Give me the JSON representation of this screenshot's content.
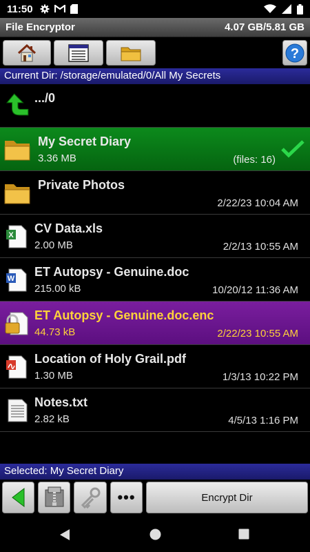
{
  "status": {
    "time": "11:50"
  },
  "title": {
    "app": "File Encryptor",
    "storage": "4.07 GB/5.81 GB"
  },
  "toolbar": {
    "home_icon": "home-icon",
    "list_icon": "list-view-icon",
    "folder_icon": "folder-icon",
    "help_icon": "help-icon"
  },
  "current_dir": "Current Dir: /storage/emulated/0/All My Secrets",
  "parent": {
    "label": ".../0"
  },
  "files": [
    {
      "name": "My Secret Diary",
      "size": "3.36 MB",
      "date": "(files: 16)",
      "type": "folder",
      "state": "selected"
    },
    {
      "name": "Private Photos",
      "size": "",
      "date": "2/22/23 10:04 AM",
      "type": "folder",
      "state": "normal"
    },
    {
      "name": "CV Data.xls",
      "size": "2.00 MB",
      "date": "2/2/13 10:55 AM",
      "type": "xls",
      "state": "normal"
    },
    {
      "name": "ET Autopsy - Genuine.doc",
      "size": "215.00 kB",
      "date": "10/20/12 11:36 AM",
      "type": "doc",
      "state": "normal"
    },
    {
      "name": "ET Autopsy - Genuine.doc.enc",
      "size": "44.73 kB",
      "date": "2/22/23 10:55 AM",
      "type": "enc",
      "state": "encrypted"
    },
    {
      "name": "Location of Holy Grail.pdf",
      "size": "1.30 MB",
      "date": "1/3/13 10:22 PM",
      "type": "pdf",
      "state": "normal"
    },
    {
      "name": "Notes.txt",
      "size": "2.82 kB",
      "date": "4/5/13 1:16 PM",
      "type": "txt",
      "state": "normal"
    }
  ],
  "selected_label": "Selected: My Secret Diary",
  "bottom": {
    "encrypt_label": "Encrypt Dir",
    "more_label": "•••"
  },
  "colors": {
    "selected": "#0c8a1c",
    "encrypted": "#7a1e9e",
    "dirbar": "#2b2b9a",
    "enc_text": "#ffd23a"
  }
}
